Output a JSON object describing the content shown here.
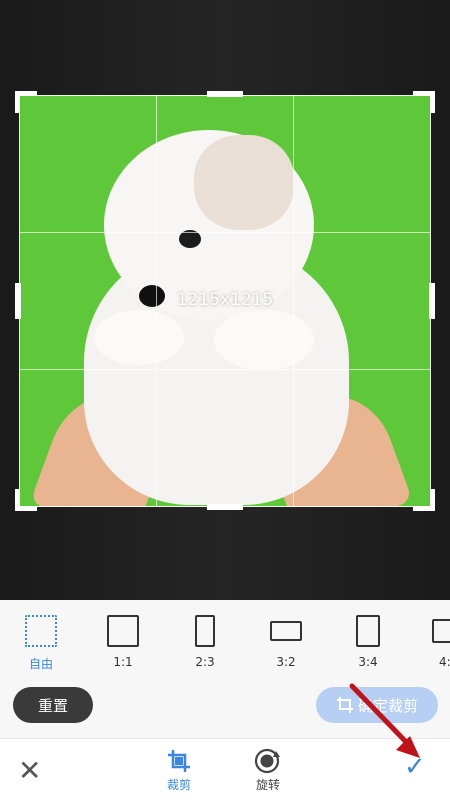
{
  "editor": {
    "dimensions_label": "1215x1215"
  },
  "ratios": [
    {
      "label": "自由",
      "active": true
    },
    {
      "label": "1:1",
      "active": false
    },
    {
      "label": "2:3",
      "active": false
    },
    {
      "label": "3:2",
      "active": false
    },
    {
      "label": "3:4",
      "active": false
    },
    {
      "label": "4:",
      "active": false
    }
  ],
  "actions": {
    "reset_label": "重置",
    "confirm_label": "确定裁剪"
  },
  "toolbar": {
    "crop_label": "裁剪",
    "rotate_label": "旋转"
  },
  "colors": {
    "accent": "#3a86e0",
    "confirm_disabled": "#b6cff2",
    "annotation_arrow": "#c0121b"
  }
}
